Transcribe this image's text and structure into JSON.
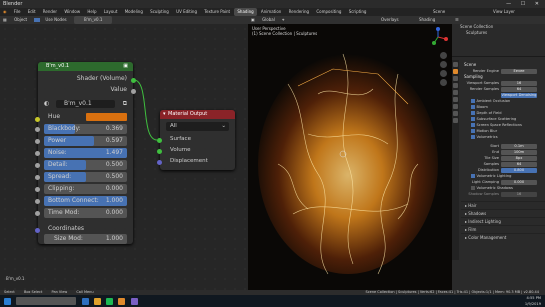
{
  "window": {
    "title": "Blender",
    "controls": "—  ☐  ✕"
  },
  "menu": {
    "items": [
      "File",
      "Edit",
      "Render",
      "Window",
      "Help"
    ],
    "workspaces": [
      "Layout",
      "Modeling",
      "Sculpting",
      "UV Editing",
      "Texture Paint",
      "Shading",
      "Animation",
      "Rendering",
      "Compositing",
      "Scripting"
    ],
    "active_workspace": "Shading",
    "scene_label": "Scene",
    "view_layer_label": "View Layer"
  },
  "node_header": {
    "editor": "Object",
    "use_nodes": "Use Nodes",
    "material": "B'm_v0.1"
  },
  "group_node": {
    "title": "B'm_v0.1",
    "out1": "Shader (Volume)",
    "out2": "Value",
    "datablock": "B'm_v0.1",
    "hue_label": "Hue",
    "hue_color": "#d9700f",
    "sliders": [
      {
        "label": "Blackbody:",
        "value": "0.369",
        "fraction": 0.369
      },
      {
        "label": "Power",
        "value": "0.597",
        "fraction": 0.597
      },
      {
        "label": "Noise:",
        "value": "1.497",
        "fraction": 1.0
      },
      {
        "label": "Detail:",
        "value": "0.500",
        "fraction": 0.5
      },
      {
        "label": "Spread:",
        "value": "0.500",
        "fraction": 0.5
      },
      {
        "label": "Clipping:",
        "value": "0.000",
        "fraction": 0.0
      },
      {
        "label": "Bottom Connect:",
        "value": "1.000",
        "fraction": 1.0
      },
      {
        "label": "Time Mod:",
        "value": "0.000",
        "fraction": 0.0
      }
    ],
    "coords_label": "Coordinates",
    "size_mod": {
      "label": "Size Mod:",
      "value": "1.000"
    }
  },
  "output_node": {
    "title": "Material Output",
    "target": "All",
    "inputs": [
      "Surface",
      "Volume",
      "Displacement"
    ]
  },
  "node_footer": "B'm_v0.1",
  "viewport_header": {
    "global": "Global",
    "overlays": "Overlays",
    "shading": "Shading"
  },
  "viewport_info": {
    "line1": "User Perspective",
    "line2": "(1) Scene Collection | Sculptures"
  },
  "right_panel": {
    "outliner_title": "Scene Collection",
    "outliner_item": "Sculptures",
    "scene": "Scene",
    "render_engine_label": "Render Engine",
    "render_engine": "Eevee",
    "sampling": "Sampling",
    "viewport_samples_label": "Viewport Samples",
    "viewport_samples": "16",
    "render_samples_label": "Render Samples",
    "render_samples": "64",
    "viewport_denoising": "Viewport Denoising",
    "effects": [
      "Ambient Occlusion",
      "Bloom",
      "Depth of Field",
      "Subsurface Scattering",
      "Screen Space Reflections",
      "Motion Blur",
      "Volumetrics"
    ],
    "volumetrics": [
      {
        "label": "Start",
        "value": "0.1m"
      },
      {
        "label": "End",
        "value": "100m"
      },
      {
        "label": "Tile Size",
        "value": "8px"
      },
      {
        "label": "Samples",
        "value": "64"
      },
      {
        "label": "Distribution",
        "value": "0.800"
      }
    ],
    "vol_lighting": "Volumetric Lighting",
    "light_clamping_label": "Light Clamping",
    "light_clamping": "0.000",
    "vol_shadows": "Volumetric Shadows",
    "shadow_samples_label": "Shadow Samples",
    "shadow_samples": "16",
    "bottom_sections": [
      "Hair",
      "Shadows",
      "Indirect Lighting",
      "Film",
      "Color Management"
    ]
  },
  "statusbar": {
    "items": [
      "Select",
      "Box Select",
      "Pan View",
      "Call Menu"
    ],
    "right": "Scene Collection | Sculptures | Verts:62 | Faces:41 | Tris:41 | Objects:1/1 | Mem: 90.3 MB | v2.80.44"
  },
  "taskbar": {
    "time": "4:55 PM",
    "date": "1/9/2019"
  },
  "colors": {
    "accent": "#e08a2c",
    "slider_fill": "#4772b3",
    "group_header": "#2d6a2d",
    "output_header": "#8a2328"
  }
}
